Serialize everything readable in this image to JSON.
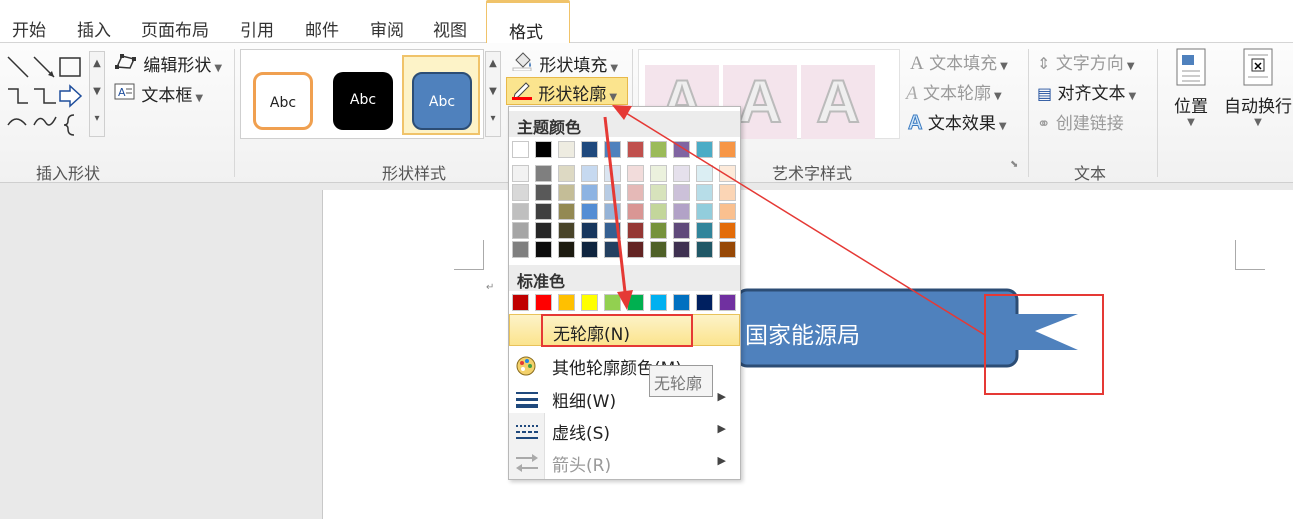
{
  "tabs": {
    "items": [
      "开始",
      "插入",
      "页面布局",
      "引用",
      "邮件",
      "审阅",
      "视图"
    ],
    "active": "格式"
  },
  "ribbon": {
    "insert_shapes": {
      "label": "插入形状",
      "edit_shape": "编辑形状",
      "text_box": "文本框"
    },
    "shape_styles": {
      "label": "形状样式",
      "samples": [
        "Abc",
        "Abc",
        "Abc"
      ],
      "fill": "形状填充",
      "outline": "形状轮廓"
    },
    "wordart": {
      "label": "艺术字样式",
      "sample": "A",
      "text_fill": "文本填充",
      "text_outline": "文本轮廓",
      "text_effect": "文本效果"
    },
    "text": {
      "label": "文本",
      "direction": "文字方向",
      "align": "对齐文本",
      "link": "创建链接"
    },
    "arrange": {
      "position": "位置",
      "wrap": "自动换行"
    }
  },
  "dropdown": {
    "theme_colors_label": "主题颜色",
    "standard_colors_label": "标准色",
    "theme_top": [
      "#ffffff",
      "#000000",
      "#eeece1",
      "#1f497d",
      "#4f81bd",
      "#c0504d",
      "#9bbb59",
      "#8064a2",
      "#4bacc6",
      "#f79646"
    ],
    "theme_tints": [
      [
        "#f2f2f2",
        "#7f7f7f",
        "#ddd9c3",
        "#c6d9f0",
        "#dbe5f1",
        "#f2dcdb",
        "#ebf1dd",
        "#e5e0ec",
        "#dbeef3",
        "#fdeada"
      ],
      [
        "#d8d8d8",
        "#595959",
        "#c4bd97",
        "#8db3e2",
        "#b8cce4",
        "#e5b9b7",
        "#d7e3bc",
        "#ccc1d9",
        "#b7dde8",
        "#fbd5b5"
      ],
      [
        "#bfbfbf",
        "#3f3f3f",
        "#938953",
        "#548dd4",
        "#95b3d7",
        "#d99694",
        "#c3d69b",
        "#b2a2c7",
        "#92cddc",
        "#fac08f"
      ],
      [
        "#a5a5a5",
        "#262626",
        "#494429",
        "#17365d",
        "#366092",
        "#953734",
        "#76923c",
        "#5f497a",
        "#31859b",
        "#e36c09"
      ],
      [
        "#7f7f7f",
        "#0c0c0c",
        "#1d1b10",
        "#0f243e",
        "#244061",
        "#632423",
        "#4f6128",
        "#3f3151",
        "#205867",
        "#974806"
      ]
    ],
    "standard": [
      "#c00000",
      "#ff0000",
      "#ffc000",
      "#ffff00",
      "#92d050",
      "#00b050",
      "#00b0f0",
      "#0070c0",
      "#002060",
      "#7030a0"
    ],
    "no_outline": "无轮廓(N)",
    "more_colors": "其他轮廓颜色(M)...",
    "weight": "粗细(W)",
    "dashes": "虚线(S)",
    "arrows": "箭头(R)",
    "tooltip": "无轮廓"
  },
  "document": {
    "shape_text": "国家能源局"
  },
  "colors": {
    "highlight": "#fbe48e",
    "annotation_red": "#e53935",
    "shape_blue": "#4f81bd",
    "active_tab_border": "#f0c36a"
  }
}
